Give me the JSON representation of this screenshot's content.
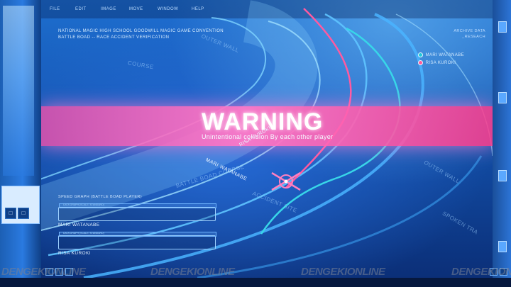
{
  "menu": [
    "FILE",
    "EDIT",
    "IMAGE",
    "MOVE",
    "WINDOW",
    "HELP"
  ],
  "header": {
    "line1": "NATIONAL MAGIC HIGH SCHOOL GOODWILL MAGIC GAME CONVENTION",
    "line2": "BATTLE BOAD -- RACE ACCIDENT VERIFICATION"
  },
  "archive": {
    "line1": "ARCHIVE DATA",
    "line2": "_RESEACH"
  },
  "legend": [
    {
      "name": "MARI WATANABE",
      "color": "#20c8d8"
    },
    {
      "name": "RISA KUROKI",
      "color": "#ff5a9a"
    }
  ],
  "warning": {
    "title": "WARNING",
    "subtitle": "Unintentional collision By each other player"
  },
  "track_labels": {
    "risa": "RISA KUROKI",
    "mari": "MARI WATANABE",
    "accident": "ACCIDENT SITE",
    "course": "BATTLE BOAD COURSE",
    "outer_top": "OUTER WALL",
    "outer_right": "OUTER WALL",
    "spoken": "SPOKEN TRA",
    "course_top": "COURSE"
  },
  "speed": {
    "title": "SPEED GRAPH (BATTLE BOAD PLAYER)",
    "box_caption": "DATA GRAPH (SCALE: STANDARD)",
    "players": [
      "MARI WATANABE",
      "RISA KUROKI"
    ]
  },
  "watermark": "DENGEKIONLINE",
  "side_controls": [
    "□",
    "□"
  ],
  "colors": {
    "accent_pink": "#ff5aa0",
    "accent_cyan": "#38d6e8"
  }
}
